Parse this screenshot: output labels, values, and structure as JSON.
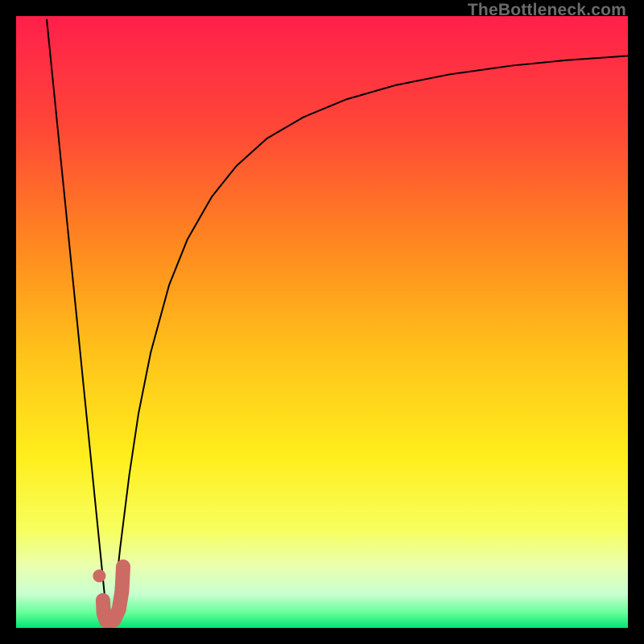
{
  "watermark": "TheBottleneck.com",
  "chart_data": {
    "type": "line",
    "title": "",
    "xlabel": "",
    "ylabel": "",
    "xlim": [
      0,
      100
    ],
    "ylim": [
      0,
      100
    ],
    "grid": false,
    "legend": false,
    "gradient_stops": [
      {
        "pos": 0.0,
        "color": "#ff1f4b"
      },
      {
        "pos": 0.18,
        "color": "#ff4637"
      },
      {
        "pos": 0.38,
        "color": "#ff8a1f"
      },
      {
        "pos": 0.55,
        "color": "#ffc21a"
      },
      {
        "pos": 0.72,
        "color": "#ffee1c"
      },
      {
        "pos": 0.84,
        "color": "#f7ff5e"
      },
      {
        "pos": 0.9,
        "color": "#eaffb0"
      },
      {
        "pos": 0.945,
        "color": "#c8ffd0"
      },
      {
        "pos": 0.975,
        "color": "#66ff99"
      },
      {
        "pos": 1.0,
        "color": "#00e676"
      }
    ],
    "series": [
      {
        "name": "left-branch",
        "stroke": "#000000",
        "stroke_width": 2,
        "x": [
          5.0,
          6.0,
          7.0,
          8.0,
          9.0,
          10.0,
          11.0,
          12.0,
          13.0,
          14.0,
          14.8
        ],
        "y": [
          99.5,
          89.6,
          79.6,
          69.7,
          59.7,
          49.8,
          39.8,
          29.9,
          19.9,
          10.0,
          2.0
        ]
      },
      {
        "name": "right-branch",
        "stroke": "#000000",
        "stroke_width": 2,
        "x": [
          15.8,
          17.0,
          18.5,
          20.0,
          22.0,
          25.0,
          28.0,
          32.0,
          36.0,
          41.0,
          47.0,
          54.0,
          62.0,
          71.0,
          81.0,
          90.0,
          100.0
        ],
        "y": [
          2.0,
          13.0,
          25.0,
          35.0,
          45.0,
          56.0,
          63.5,
          70.5,
          75.5,
          80.0,
          83.5,
          86.4,
          88.7,
          90.5,
          91.9,
          92.8,
          93.5
        ]
      },
      {
        "name": "j-mark",
        "stroke": "#cc6b63",
        "stroke_width": 18,
        "linecap": "round",
        "x": [
          14.2,
          14.3,
          14.7,
          15.3,
          16.0,
          16.8,
          17.3,
          17.5
        ],
        "y": [
          4.5,
          2.4,
          1.2,
          0.9,
          1.3,
          3.0,
          6.0,
          10.0
        ]
      }
    ],
    "points": [
      {
        "name": "dot",
        "x": 13.6,
        "y": 8.5,
        "r": 8,
        "fill": "#cc6b63"
      }
    ]
  }
}
